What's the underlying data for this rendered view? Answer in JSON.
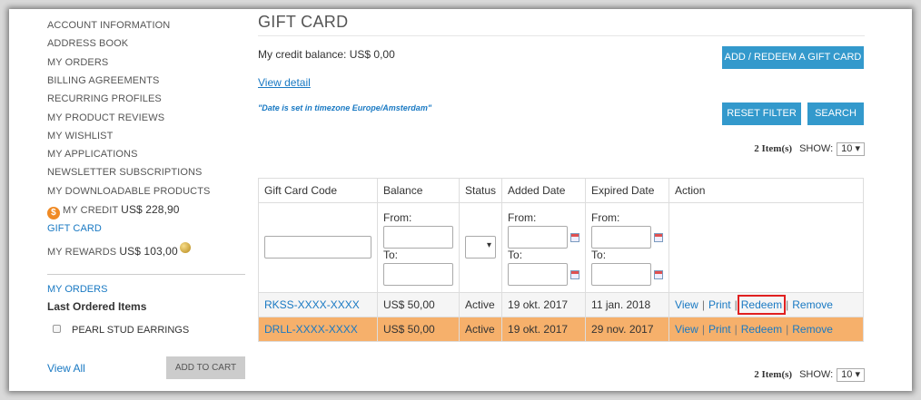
{
  "sidebar": {
    "nav": [
      "ACCOUNT INFORMATION",
      "ADDRESS BOOK",
      "MY ORDERS",
      "BILLING AGREEMENTS",
      "RECURRING PROFILES",
      "MY PRODUCT REVIEWS",
      "MY WISHLIST",
      "MY APPLICATIONS",
      "NEWSLETTER SUBSCRIPTIONS",
      "MY DOWNLOADABLE PRODUCTS"
    ],
    "credit": {
      "label": "MY CREDIT",
      "amount": "US$ 228,90",
      "icon": "dollar-coin-icon",
      "icon_glyph": "$"
    },
    "gift_card": "GIFT CARD",
    "rewards": {
      "label": "MY REWARDS",
      "amount": "US$ 103,00",
      "icon": "reward-point-icon"
    },
    "my_orders_title": "MY ORDERS",
    "last_ordered_title": "Last Ordered Items",
    "last_ordered_item": "PEARL STUD EARRINGS",
    "view_all": "View All",
    "add_to_cart": "ADD TO CART"
  },
  "main": {
    "title": "GIFT CARD",
    "credit_balance": "My credit balance: US$ 0,00",
    "add_redeem_button": "ADD / REDEEM A GIFT CARD",
    "view_detail": "View detail",
    "timezone_note": "\"Date is set in timezone Europe/Amsterdam\"",
    "reset_filter_button": "RESET FILTER",
    "search_button": "SEARCH",
    "pager": {
      "count": "2 Item(s)",
      "show_label": "SHOW:",
      "show_value": "10 ▾"
    },
    "table": {
      "headers": [
        "Gift Card Code",
        "Balance",
        "Status",
        "Added Date",
        "Expired Date",
        "Action"
      ],
      "filter": {
        "from": "From:",
        "to": "To:"
      },
      "rows": [
        {
          "code": "RKSS-XXXX-XXXX",
          "balance": "US$ 50,00",
          "status": "Active",
          "added": "19 okt. 2017",
          "expired": "11 jan. 2018"
        },
        {
          "code": "DRLL-XXXX-XXXX",
          "balance": "US$ 50,00",
          "status": "Active",
          "added": "19 okt. 2017",
          "expired": "29 nov. 2017"
        }
      ],
      "actions": {
        "view": "View",
        "print": "Print",
        "redeem": "Redeem",
        "remove": "Remove",
        "separator": "|"
      }
    }
  },
  "colors": {
    "accent": "#3399cc",
    "link": "#1979c3",
    "highlight_row": "#f6b06b",
    "annotation_box": "#e02020"
  }
}
